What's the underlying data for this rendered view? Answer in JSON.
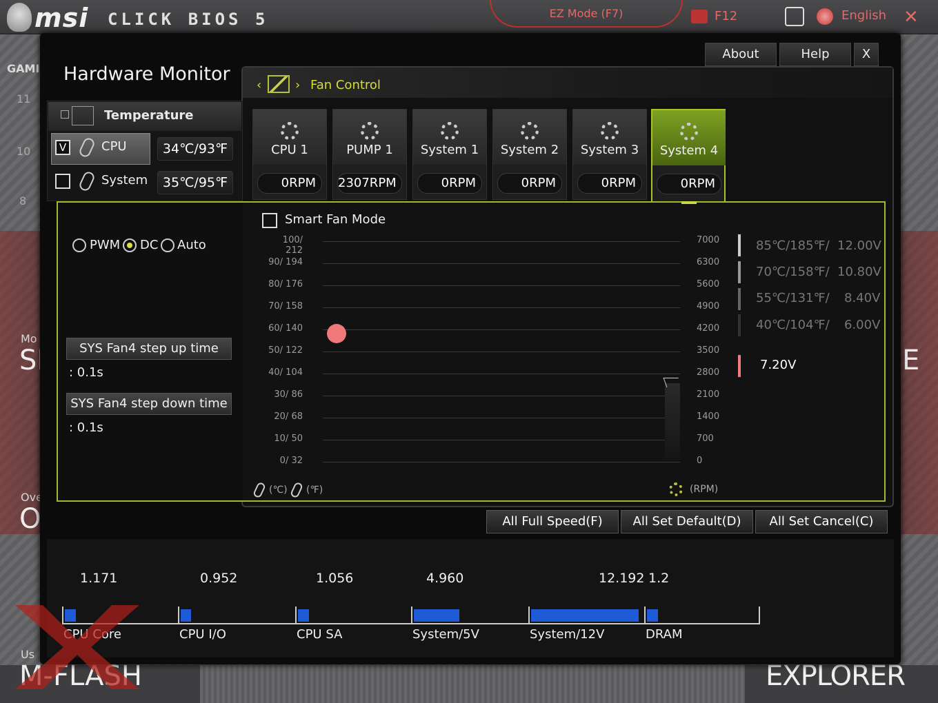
{
  "app": {
    "brand": "msi",
    "product": "CLICK BIOS 5",
    "ez_mode": "EZ Mode (F7)",
    "f12": "F12",
    "language": "English",
    "close": "✕"
  },
  "background": {
    "left_labels": [
      "GAMI",
      "11",
      "10",
      "8",
      "Mo",
      "SI",
      "Ove",
      "O",
      "Us",
      "M-FLASH"
    ],
    "right_labels": [
      "E",
      "EXPLORER"
    ]
  },
  "panel": {
    "title": "Hardware Monitor",
    "about": "About",
    "help": "Help",
    "close": "X",
    "breadcrumb_prev": "‹",
    "breadcrumb_next": "›",
    "section": "Fan Control"
  },
  "temperature": {
    "title": "Temperature",
    "rows": [
      {
        "label": "CPU",
        "checked": "V",
        "value": "34℃/93℉"
      },
      {
        "label": "System",
        "checked": "",
        "value": "35℃/95℉"
      }
    ]
  },
  "fans": [
    {
      "name": "CPU 1",
      "rpm": "0RPM"
    },
    {
      "name": "PUMP 1",
      "rpm": "2307RPM"
    },
    {
      "name": "System 1",
      "rpm": "0RPM"
    },
    {
      "name": "System 2",
      "rpm": "0RPM"
    },
    {
      "name": "System 3",
      "rpm": "0RPM"
    },
    {
      "name": "System 4",
      "rpm": "0RPM"
    }
  ],
  "selected_fan": "System 4",
  "mode": {
    "options": [
      "PWM",
      "DC",
      "Auto"
    ],
    "selected": "DC"
  },
  "step_up": {
    "label": "SYS Fan4 step up time",
    "value": ": 0.1s"
  },
  "step_down": {
    "label": "SYS Fan4 step down time",
    "value": ": 0.1s"
  },
  "smart_fan_mode": "Smart Fan Mode",
  "chart_data": {
    "type": "scatter",
    "y_left_ticks": [
      "100/ 212",
      "90/ 194",
      "80/ 176",
      "70/ 158",
      "60/ 140",
      "50/ 122",
      "40/ 104",
      "30/  86",
      "20/  68",
      "10/  50",
      "0/  32"
    ],
    "y_right_ticks": [
      "7000",
      "6300",
      "5600",
      "4900",
      "4200",
      "3500",
      "2800",
      "2100",
      "1400",
      "700",
      "0"
    ],
    "point": {
      "temp_c": 58,
      "color": "#f07a7a"
    },
    "x_units_left": [
      "(℃)",
      "(℉)"
    ],
    "x_units_right": "(RPM)",
    "legend": [
      {
        "label": "85℃/185℉/",
        "voltage": "12.00V"
      },
      {
        "label": "70℃/158℉/",
        "voltage": "10.80V"
      },
      {
        "label": "55℃/131℉/",
        "voltage": "8.40V"
      },
      {
        "label": "40℃/104℉/",
        "voltage": "6.00V"
      }
    ],
    "current_voltage": "7.20V"
  },
  "actions": {
    "full_speed": "All Full Speed(F)",
    "set_default": "All Set Default(D)",
    "set_cancel": "All Set Cancel(C)"
  },
  "voltages": [
    {
      "label": "CPU Core",
      "value": "1.171",
      "level": 0.1
    },
    {
      "label": "CPU I/O",
      "value": "0.952",
      "level": 0.09
    },
    {
      "label": "CPU SA",
      "value": "1.056",
      "level": 0.1
    },
    {
      "label": "System/5V",
      "value": "4.960",
      "level": 0.4
    },
    {
      "label": "System/12V",
      "value": "12.192",
      "level": 0.95
    },
    {
      "label": "DRAM",
      "value": "1.2",
      "level": 0.1
    }
  ],
  "colors": {
    "accent": "#a9c226",
    "bar": "#1f5bd6",
    "brand_red": "#e06a6a"
  }
}
